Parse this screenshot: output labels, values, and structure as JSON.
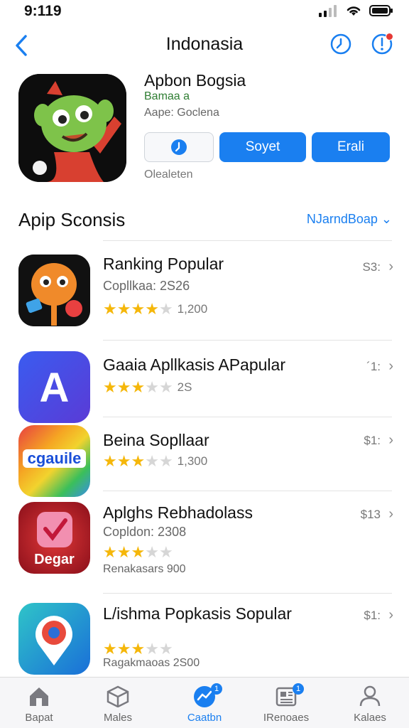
{
  "status_bar": {
    "time": "9:119"
  },
  "nav": {
    "title": "Indonasia"
  },
  "hero": {
    "name": "Apbon Bogsia",
    "subtitle": "Bamaa a",
    "meta": "Aape: Goclena",
    "button_primary": "Soyet",
    "button_secondary": "Erali",
    "footer": "Olealeten"
  },
  "section": {
    "title": "Apip Sconsis",
    "link": "NJarndBoap"
  },
  "apps": [
    {
      "name": "Ranking Popular",
      "detail": "Copllkaa: 2S26",
      "stars": 4,
      "count": "1,200",
      "extra": "",
      "price": "S3:"
    },
    {
      "name": "Gaaia  Apllkasis APapular",
      "detail": "",
      "stars": 3,
      "count": "2S",
      "extra": "",
      "price": "´1:"
    },
    {
      "name": "Beina Sopllaar",
      "detail": "",
      "stars": 3,
      "count": "1,300",
      "extra": "",
      "price": "$1:"
    },
    {
      "name": "Aplghs Rebhadolass",
      "detail": "Copldon: 2308",
      "stars": 3,
      "count": "",
      "extra": "Renakasars 900",
      "price": "$13"
    },
    {
      "name": "L/ishma Popkasis Sopular",
      "detail": "",
      "stars": 3,
      "count": "",
      "extra": "Ragakmaoas 2S00",
      "price": "$1:"
    }
  ],
  "app_icon_texts": {
    "app2": "A",
    "app3": "cgauile",
    "app4": "Degar"
  },
  "tabs": [
    {
      "label": "Bapat",
      "icon": "home-icon"
    },
    {
      "label": "Males",
      "icon": "box-icon"
    },
    {
      "label": "Caatbn",
      "icon": "chart-icon",
      "badge": "1"
    },
    {
      "label": "IRenoaes",
      "icon": "news-icon",
      "badge": "1"
    },
    {
      "label": "Kalaes",
      "icon": "person-icon"
    }
  ],
  "colors": {
    "accent": "#1a7ff0",
    "star": "#f5b70a",
    "badge": "#e53935"
  }
}
